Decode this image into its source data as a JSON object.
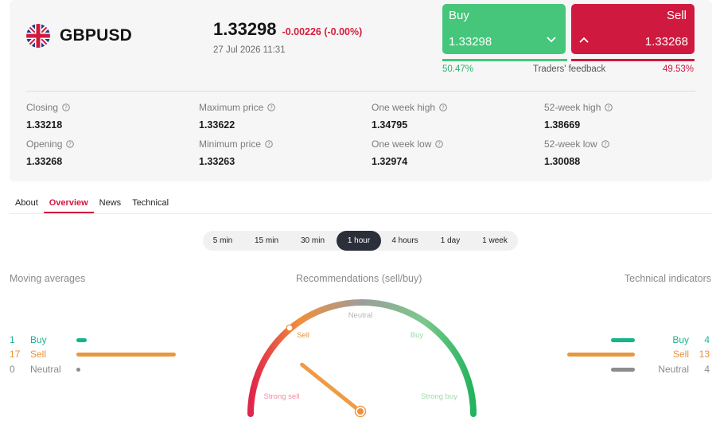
{
  "instrument": {
    "symbol": "GBPUSD",
    "flag_icon": "uk-flag-icon"
  },
  "quote": {
    "price": "1.33298",
    "change": "-0.00226 (-0.00%)",
    "datetime": "27 Jul 2026 11:31"
  },
  "trade": {
    "buy_label": "Buy",
    "buy_price": "1.33298",
    "sell_label": "Sell",
    "sell_price": "1.33268",
    "buy_color": "#45c67a",
    "sell_color": "#d0193f"
  },
  "feedback": {
    "buy_pct": "50.47%",
    "sell_pct": "49.53%",
    "label": "Traders' feedback",
    "buy_fraction": 0.5047
  },
  "stats": [
    {
      "label": "Closing",
      "value": "1.33218"
    },
    {
      "label": "Maximum price",
      "value": "1.33622"
    },
    {
      "label": "One week high",
      "value": "1.34795"
    },
    {
      "label": "52-week high",
      "value": "1.38669"
    },
    {
      "label": "Opening",
      "value": "1.33268"
    },
    {
      "label": "Minimum price",
      "value": "1.33263"
    },
    {
      "label": "One week low",
      "value": "1.32974"
    },
    {
      "label": "52-week low",
      "value": "1.30088"
    }
  ],
  "tabs": [
    {
      "label": "About",
      "active": false
    },
    {
      "label": "Overview",
      "active": true
    },
    {
      "label": "News",
      "active": false
    },
    {
      "label": "Technical",
      "active": false
    }
  ],
  "timeframes": [
    {
      "label": "5 min",
      "active": false
    },
    {
      "label": "15 min",
      "active": false
    },
    {
      "label": "30 min",
      "active": false
    },
    {
      "label": "1 hour",
      "active": true
    },
    {
      "label": "4 hours",
      "active": false
    },
    {
      "label": "1 day",
      "active": false
    },
    {
      "label": "1 week",
      "active": false
    }
  ],
  "moving_averages": {
    "title": "Moving averages",
    "rows": [
      {
        "count": "1",
        "label": "Buy"
      },
      {
        "count": "17",
        "label": "Sell"
      },
      {
        "count": "0",
        "label": "Neutral"
      }
    ]
  },
  "recommendations": {
    "title": "Recommendations (sell/buy)",
    "labels": {
      "strong_sell": "Strong sell",
      "sell": "Sell",
      "neutral": "Neutral",
      "buy": "Buy",
      "strong_buy": "Strong buy"
    },
    "active": "Sell",
    "needle_value": -0.6
  },
  "technical_indicators": {
    "title": "Technical indicators",
    "rows": [
      {
        "count": "4",
        "label": "Buy"
      },
      {
        "count": "13",
        "label": "Sell"
      },
      {
        "count": "4",
        "label": "Neutral"
      }
    ]
  }
}
